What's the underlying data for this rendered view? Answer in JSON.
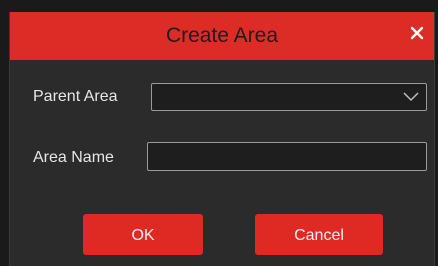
{
  "dialog": {
    "title": "Create Area",
    "close_icon": "close-icon",
    "parent_area": {
      "label": "Parent Area",
      "selected_value": "",
      "dropdown_icon": "chevron-down-icon"
    },
    "area_name": {
      "label": "Area Name",
      "value": "",
      "placeholder": ""
    },
    "buttons": {
      "ok_label": "OK",
      "cancel_label": "Cancel"
    }
  },
  "colors": {
    "accent": "#dc2c25",
    "background": "#2b2b2b",
    "field_border": "#9a9a9a",
    "text": "#e6e6e6"
  }
}
